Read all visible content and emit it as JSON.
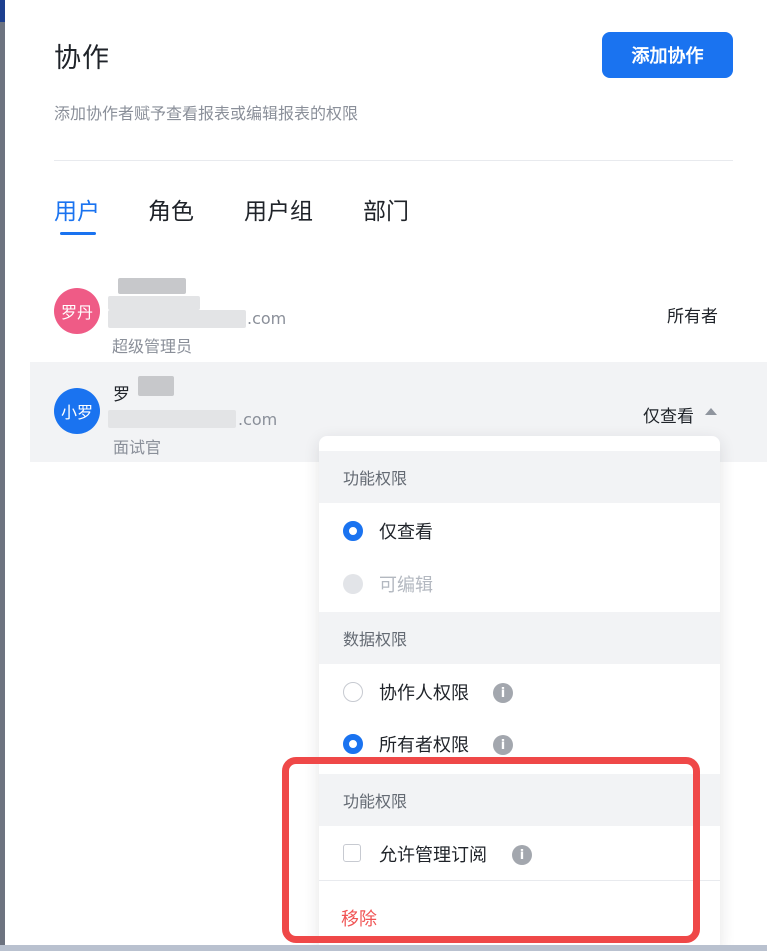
{
  "header": {
    "title": "协作",
    "subtitle": "添加协作者赋予查看报表或编辑报表的权限",
    "add_button": "添加协作"
  },
  "tabs": [
    {
      "label": "用户",
      "active": true
    },
    {
      "label": "角色",
      "active": false
    },
    {
      "label": "用户组",
      "active": false
    },
    {
      "label": "部门",
      "active": false
    }
  ],
  "collaborators": [
    {
      "avatar_text": "罗丹",
      "avatar_color": "#ef5b86",
      "name": "",
      "email_suffix": ".com",
      "role": "超级管理员",
      "permission": "所有者"
    },
    {
      "avatar_text": "小罗",
      "avatar_color": "#1a73f0",
      "name": "罗",
      "email_suffix": ".com",
      "role": "面试官",
      "permission": "仅查看"
    }
  ],
  "dropdown": {
    "section1_title": "功能权限",
    "view_only": "仅查看",
    "editable": "可编辑",
    "section2_title": "数据权限",
    "collaborator_perm": "协作人权限",
    "owner_perm": "所有者权限",
    "section3_title": "功能权限",
    "allow_subscription": "允许管理订阅",
    "remove": "移除",
    "info_glyph": "i"
  },
  "colors": {
    "primary": "#1a73f0",
    "danger": "#f05555",
    "highlight": "#ef4848"
  }
}
